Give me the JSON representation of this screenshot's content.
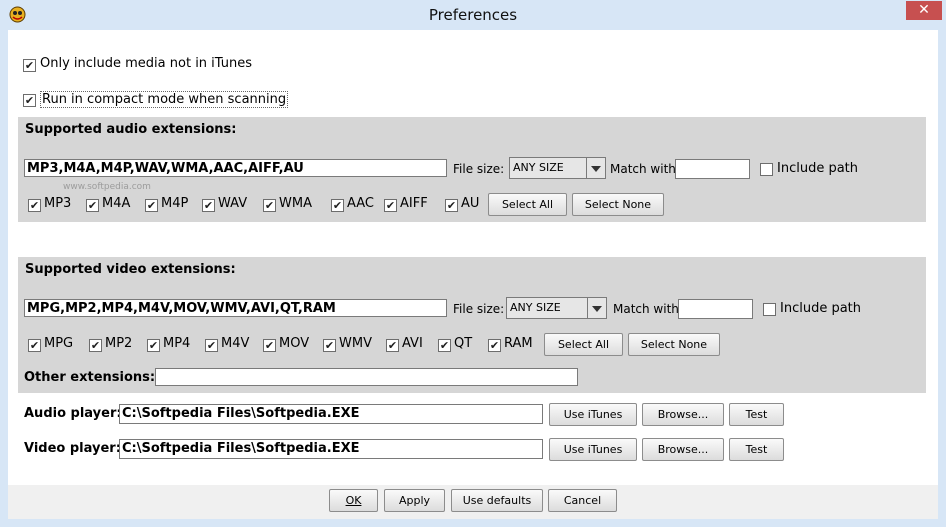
{
  "window": {
    "title": "Preferences",
    "close_glyph": "✕",
    "app_icon": "app-icon"
  },
  "options": {
    "only_itunes": {
      "label": "Only include media not in iTunes",
      "checked": true
    },
    "compact_mode": {
      "label": "Run in compact mode when scanning",
      "checked": true
    }
  },
  "audio": {
    "heading": "Supported audio extensions:",
    "extensions_value": "MP3,M4A,M4P,WAV,WMA,AAC,AIFF,AU",
    "file_size_label": "File size:",
    "file_size_value": "ANY SIZE",
    "match_label": "Match with:",
    "match_value": "",
    "include_path_label": "Include path",
    "include_path_checked": false,
    "types": [
      "MP3",
      "M4A",
      "M4P",
      "WAV",
      "WMA",
      "AAC",
      "AIFF",
      "AU"
    ],
    "select_all": "Select All",
    "select_none": "Select None"
  },
  "video": {
    "heading": "Supported video extensions:",
    "extensions_value": "MPG,MP2,MP4,M4V,MOV,WMV,AVI,QT,RAM",
    "file_size_label": "File size:",
    "file_size_value": "ANY SIZE",
    "match_label": "Match with:",
    "match_value": "",
    "include_path_label": "Include path",
    "include_path_checked": false,
    "types": [
      "MPG",
      "MP2",
      "MP4",
      "M4V",
      "MOV",
      "WMV",
      "AVI",
      "QT",
      "RAM"
    ],
    "select_all": "Select All",
    "select_none": "Select None",
    "other_label": "Other extensions:",
    "other_value": ""
  },
  "players": {
    "audio_label": "Audio player:",
    "audio_value": "C:\\Softpedia Files\\Softpedia.EXE",
    "video_label": "Video player:",
    "video_value": "C:\\Softpedia Files\\Softpedia.EXE",
    "use_itunes": "Use iTunes",
    "browse": "Browse...",
    "test": "Test"
  },
  "buttons": {
    "ok": "OK",
    "apply": "Apply",
    "defaults": "Use defaults",
    "cancel": "Cancel"
  },
  "watermark": "www.softpedia.com",
  "check_glyph": "✔"
}
